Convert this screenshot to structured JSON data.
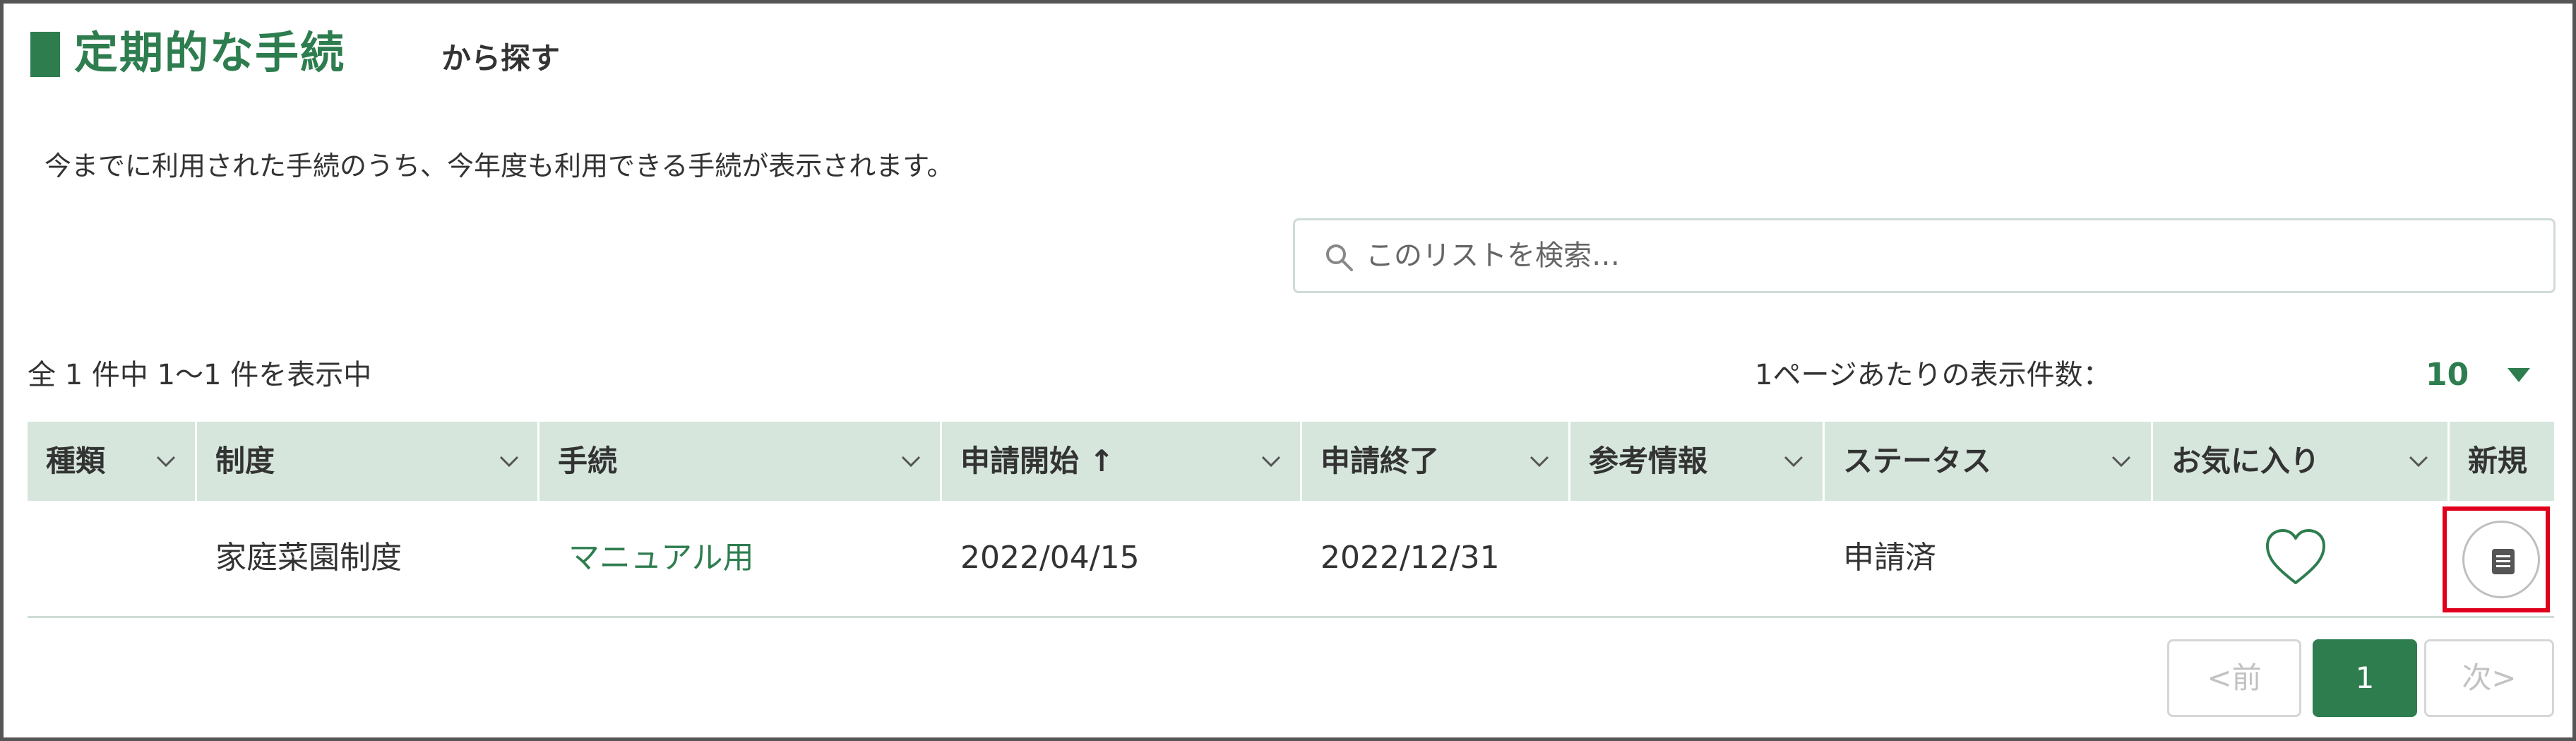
{
  "heading": {
    "title": "定期的な手続",
    "subtitle": "から探す"
  },
  "description": "今までに利用された手続のうち、今年度も利用できる手続が表示されます。",
  "search": {
    "placeholder": "このリストを検索…",
    "value": ""
  },
  "count_text": "全 1 件中 1～1 件を表示中",
  "per_page": {
    "label": "1ページあたりの表示件数：",
    "value": "10"
  },
  "table": {
    "columns": [
      {
        "key": "type",
        "label": "種類",
        "sortable": true
      },
      {
        "key": "system",
        "label": "制度",
        "sortable": true
      },
      {
        "key": "procedure",
        "label": "手続",
        "sortable": true
      },
      {
        "key": "start",
        "label": "申請開始 ↑",
        "sortable": true
      },
      {
        "key": "end",
        "label": "申請終了",
        "sortable": true
      },
      {
        "key": "reference",
        "label": "参考情報",
        "sortable": true
      },
      {
        "key": "status",
        "label": "ステータス",
        "sortable": true
      },
      {
        "key": "favorite",
        "label": "お気に入り",
        "sortable": true
      },
      {
        "key": "new",
        "label": "新規",
        "sortable": false
      }
    ],
    "rows": [
      {
        "type": "",
        "system": "家庭菜園制度",
        "procedure": "マニュアル用",
        "start": "2022/04/15",
        "end": "2022/12/31",
        "reference": "",
        "status": "申請済",
        "favorite_icon": "heart-outline-icon",
        "new_icon": "document-icon"
      }
    ]
  },
  "pagination": {
    "prev": "<前",
    "current": "1",
    "next": "次>"
  },
  "colors": {
    "accent": "#2e7d4f",
    "header_bg": "#d6e6dd",
    "highlight": "#e0001b"
  }
}
